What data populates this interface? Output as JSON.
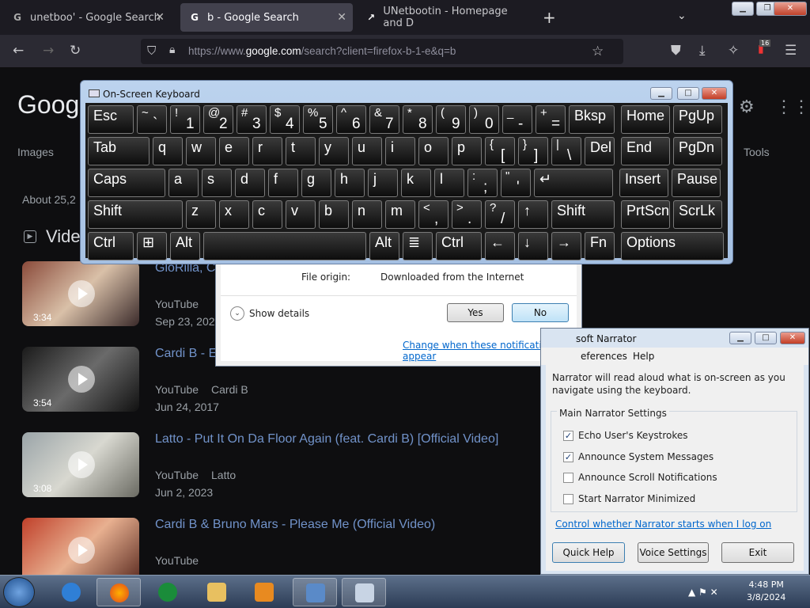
{
  "browser": {
    "tabs": [
      {
        "title": "unetboo' - Google Search",
        "favicon": "G"
      },
      {
        "title": "b - Google Search",
        "favicon": "G"
      },
      {
        "title": "UNetbootin - Homepage and D",
        "favicon": "↗"
      }
    ],
    "new_tab": "+",
    "list_tabs": "⌄",
    "url_prefix": "https://www.",
    "url_host": "google.com",
    "url_path": "/search?client=firefox-b-1-e&q=b",
    "extensions_badge": "16"
  },
  "google": {
    "logo": "Googl",
    "nav_images": "Images",
    "nav_tools": "Tools",
    "about": "About 25,2",
    "videos_heading": "Vide",
    "videos": [
      {
        "title": "GloRilla, C",
        "source": "YouTube",
        "channel": "",
        "date": "Sep 23, 2022",
        "duration": "3:34"
      },
      {
        "title": "Cardi B - E",
        "source": "YouTube",
        "channel": "Cardi B",
        "date": "Jun 24, 2017",
        "duration": "3:54"
      },
      {
        "title": "Latto - Put It On Da Floor Again (feat. Cardi B) [Official Video]",
        "source": "YouTube",
        "channel": "Latto",
        "date": "Jun 2, 2023",
        "duration": "3:08"
      },
      {
        "title": "Cardi B & Bruno Mars - Please Me (Official Video)",
        "source": "YouTube",
        "channel": "",
        "date": "",
        "duration": ""
      }
    ]
  },
  "uac": {
    "origin_label": "File origin:",
    "origin_value": "Downloaded from the Internet",
    "show_details": "Show details",
    "yes": "Yes",
    "no": "No",
    "change_link": "Change when these notifications appear"
  },
  "osk": {
    "title": "On-Screen Keyboard",
    "keys": [
      {
        "id": "esc",
        "label": "Esc"
      },
      {
        "id": "tilde",
        "upper": "~",
        "lower": "`"
      },
      {
        "id": "1",
        "upper": "!",
        "lower": "1"
      },
      {
        "id": "2",
        "upper": "@",
        "lower": "2"
      },
      {
        "id": "3",
        "upper": "#",
        "lower": "3"
      },
      {
        "id": "4",
        "upper": "$",
        "lower": "4"
      },
      {
        "id": "5",
        "upper": "%",
        "lower": "5"
      },
      {
        "id": "6",
        "upper": "^",
        "lower": "6"
      },
      {
        "id": "7",
        "upper": "&",
        "lower": "7"
      },
      {
        "id": "8",
        "upper": "*",
        "lower": "8"
      },
      {
        "id": "9",
        "upper": "(",
        "lower": "9"
      },
      {
        "id": "0",
        "upper": ")",
        "lower": "0"
      },
      {
        "id": "minus",
        "upper": "_",
        "lower": "-"
      },
      {
        "id": "equals",
        "upper": "+",
        "lower": "="
      },
      {
        "id": "bksp",
        "label": "Bksp"
      },
      {
        "id": "home",
        "label": "Home"
      },
      {
        "id": "pgup",
        "label": "PgUp"
      },
      {
        "id": "tab",
        "label": "Tab"
      },
      {
        "id": "q",
        "label": "q"
      },
      {
        "id": "w",
        "label": "w"
      },
      {
        "id": "e",
        "label": "e"
      },
      {
        "id": "r",
        "label": "r"
      },
      {
        "id": "t",
        "label": "t"
      },
      {
        "id": "y",
        "label": "y"
      },
      {
        "id": "u",
        "label": "u"
      },
      {
        "id": "i",
        "label": "i"
      },
      {
        "id": "o",
        "label": "o"
      },
      {
        "id": "p",
        "label": "p"
      },
      {
        "id": "lbracket",
        "upper": "{",
        "lower": "["
      },
      {
        "id": "rbracket",
        "upper": "}",
        "lower": "]"
      },
      {
        "id": "backslash",
        "upper": "|",
        "lower": "\\"
      },
      {
        "id": "del",
        "label": "Del"
      },
      {
        "id": "end",
        "label": "End"
      },
      {
        "id": "pgdn",
        "label": "PgDn"
      },
      {
        "id": "caps",
        "label": "Caps"
      },
      {
        "id": "a",
        "label": "a"
      },
      {
        "id": "s",
        "label": "s"
      },
      {
        "id": "d",
        "label": "d"
      },
      {
        "id": "f",
        "label": "f"
      },
      {
        "id": "g",
        "label": "g"
      },
      {
        "id": "h",
        "label": "h"
      },
      {
        "id": "j",
        "label": "j"
      },
      {
        "id": "k",
        "label": "k"
      },
      {
        "id": "l",
        "label": "l"
      },
      {
        "id": "semicolon",
        "upper": ":",
        "lower": ";"
      },
      {
        "id": "quote",
        "upper": "\"",
        "lower": "'"
      },
      {
        "id": "enter",
        "label": "↵"
      },
      {
        "id": "insert",
        "label": "Insert"
      },
      {
        "id": "pause",
        "label": "Pause"
      },
      {
        "id": "lshift",
        "label": "Shift"
      },
      {
        "id": "z",
        "label": "z"
      },
      {
        "id": "x",
        "label": "x"
      },
      {
        "id": "c",
        "label": "c"
      },
      {
        "id": "v",
        "label": "v"
      },
      {
        "id": "b",
        "label": "b"
      },
      {
        "id": "n",
        "label": "n"
      },
      {
        "id": "m",
        "label": "m"
      },
      {
        "id": "comma",
        "upper": "<",
        "lower": ","
      },
      {
        "id": "period",
        "upper": ">",
        "lower": "."
      },
      {
        "id": "slash",
        "upper": "?",
        "lower": "/"
      },
      {
        "id": "up",
        "label": "↑"
      },
      {
        "id": "rshift",
        "label": "Shift"
      },
      {
        "id": "prtscn",
        "label": "PrtScn"
      },
      {
        "id": "scrlk",
        "label": "ScrLk"
      },
      {
        "id": "lctrl",
        "label": "Ctrl"
      },
      {
        "id": "win",
        "label": "⊞"
      },
      {
        "id": "lalt",
        "label": "Alt"
      },
      {
        "id": "space",
        "label": ""
      },
      {
        "id": "ralt",
        "label": "Alt"
      },
      {
        "id": "menu",
        "label": "≣"
      },
      {
        "id": "rctrl",
        "label": "Ctrl"
      },
      {
        "id": "left",
        "label": "←"
      },
      {
        "id": "down",
        "label": "↓"
      },
      {
        "id": "right",
        "label": "→"
      },
      {
        "id": "fn",
        "label": "Fn"
      },
      {
        "id": "options",
        "label": "Options"
      }
    ]
  },
  "narrator": {
    "title": "soft Narrator",
    "menu_preferences": "eferences",
    "menu_help": "Help",
    "description": "Narrator will read aloud what is on-screen as you navigate using the keyboard.",
    "group_label": "Main Narrator Settings",
    "options": [
      {
        "label": "Echo User's Keystrokes",
        "checked": true
      },
      {
        "label": "Announce System Messages",
        "checked": true
      },
      {
        "label": "Announce Scroll Notifications",
        "checked": false
      },
      {
        "label": "Start Narrator Minimized",
        "checked": false
      }
    ],
    "logon_link": "Control whether Narrator starts when I log on",
    "quick_help": "Quick Help",
    "voice_settings": "Voice Settings",
    "exit": "Exit"
  },
  "taskbar": {
    "time": "4:48 PM",
    "date": "3/8/2024"
  },
  "colors": {
    "link": "#8ab4f8",
    "firefox_toolbar": "#2b2a33",
    "osk_key": "#1f1f1f"
  }
}
